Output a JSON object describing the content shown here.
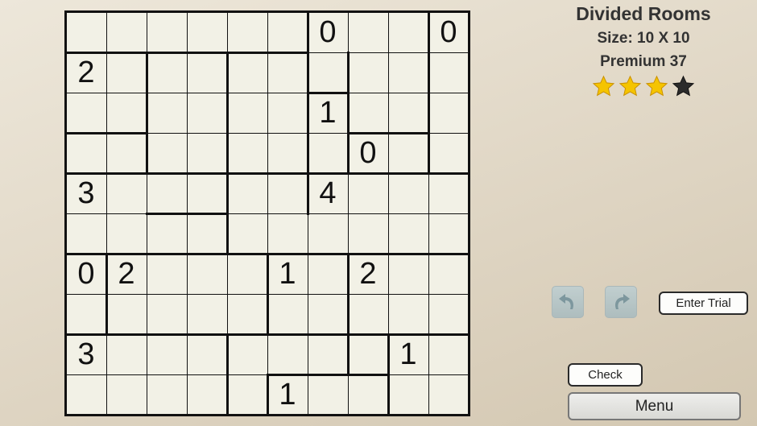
{
  "game": {
    "title": "Divided Rooms",
    "size": "Size: 10 X 10",
    "puzzle": "Premium 37",
    "difficulty_stars": 3,
    "max_stars": 4
  },
  "board": {
    "rows": 10,
    "cols": 10,
    "cells": [
      [
        "",
        "",
        "",
        "",
        "",
        "",
        "0",
        "",
        "",
        "0"
      ],
      [
        "2",
        "",
        "",
        "",
        "",
        "",
        "",
        "",
        "",
        ""
      ],
      [
        "",
        "",
        "",
        "",
        "",
        "",
        "1",
        "",
        "",
        ""
      ],
      [
        "",
        "",
        "",
        "",
        "",
        "",
        "",
        "0",
        "",
        ""
      ],
      [
        "3",
        "",
        "",
        "",
        "",
        "",
        "4",
        "",
        "",
        ""
      ],
      [
        "",
        "",
        "",
        "",
        "",
        "",
        "",
        "",
        "",
        ""
      ],
      [
        "0",
        "2",
        "",
        "",
        "",
        "1",
        "",
        "2",
        "",
        ""
      ],
      [
        "",
        "",
        "",
        "",
        "",
        "",
        "",
        "",
        "",
        ""
      ],
      [
        "3",
        "",
        "",
        "",
        "",
        "",
        "",
        "",
        "1",
        ""
      ],
      [
        "",
        "",
        "",
        "",
        "",
        "1",
        "",
        "",
        "",
        ""
      ]
    ],
    "room_borders": {
      "horizontal": [
        [
          1,
          0,
          6
        ],
        [
          3,
          0,
          2
        ],
        [
          2,
          6,
          7
        ],
        [
          3,
          7,
          9
        ],
        [
          4,
          0,
          10
        ],
        [
          5,
          2,
          4
        ],
        [
          6,
          0,
          10
        ],
        [
          8,
          0,
          7
        ],
        [
          8,
          7,
          10
        ],
        [
          9,
          5,
          8
        ]
      ],
      "vertical": [
        [
          6,
          0,
          1
        ],
        [
          9,
          0,
          1
        ],
        [
          2,
          1,
          4
        ],
        [
          4,
          1,
          4
        ],
        [
          6,
          1,
          4
        ],
        [
          7,
          1,
          4
        ],
        [
          9,
          1,
          4
        ],
        [
          6,
          4,
          5
        ],
        [
          4,
          4,
          6
        ],
        [
          1,
          6,
          8
        ],
        [
          5,
          6,
          8
        ],
        [
          7,
          6,
          8
        ],
        [
          4,
          8,
          10
        ],
        [
          7,
          8,
          9
        ],
        [
          8,
          8,
          10
        ],
        [
          5,
          9,
          10
        ]
      ]
    }
  },
  "controls": {
    "undo": "undo",
    "redo": "redo",
    "trial_label": "Enter Trial",
    "check_label": "Check",
    "menu_label": "Menu"
  },
  "colors": {
    "cell_bg": "#f2f1e6",
    "grid_line": "#111111",
    "star_filled": "#f5c400",
    "star_empty": "#2b2b2b",
    "arrow_button": "#a9c1c9"
  }
}
